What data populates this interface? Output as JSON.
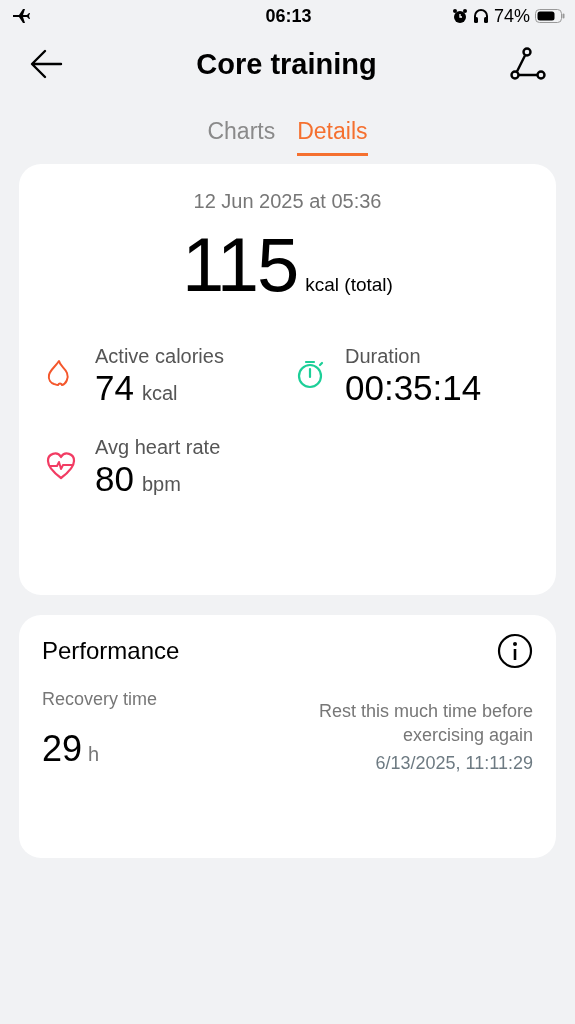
{
  "status_bar": {
    "time": "06:13",
    "battery": "74%"
  },
  "header": {
    "title": "Core training"
  },
  "tabs": [
    {
      "label": "Charts",
      "selected": false
    },
    {
      "label": "Details",
      "selected": true
    }
  ],
  "summary": {
    "date": "12 Jun 2025 at 05:36",
    "total": "115",
    "total_unit": "kcal (total)",
    "stats": [
      {
        "kind": "flame",
        "color": "#f4572c",
        "label": "Active calories",
        "value": "74",
        "unit": "kcal"
      },
      {
        "kind": "stopwatch",
        "color": "#1dcf98",
        "label": "Duration",
        "value": "00:35:14"
      },
      {
        "kind": "heart",
        "color": "#f23c63",
        "label": "Avg heart rate",
        "value": "80",
        "unit": "bpm"
      }
    ]
  },
  "performance": {
    "title": "Performance",
    "label": "Recovery time",
    "value": "29",
    "unit": "h",
    "note": "Rest this much time before exercising again",
    "until": "6/13/2025, 11:11:29"
  }
}
